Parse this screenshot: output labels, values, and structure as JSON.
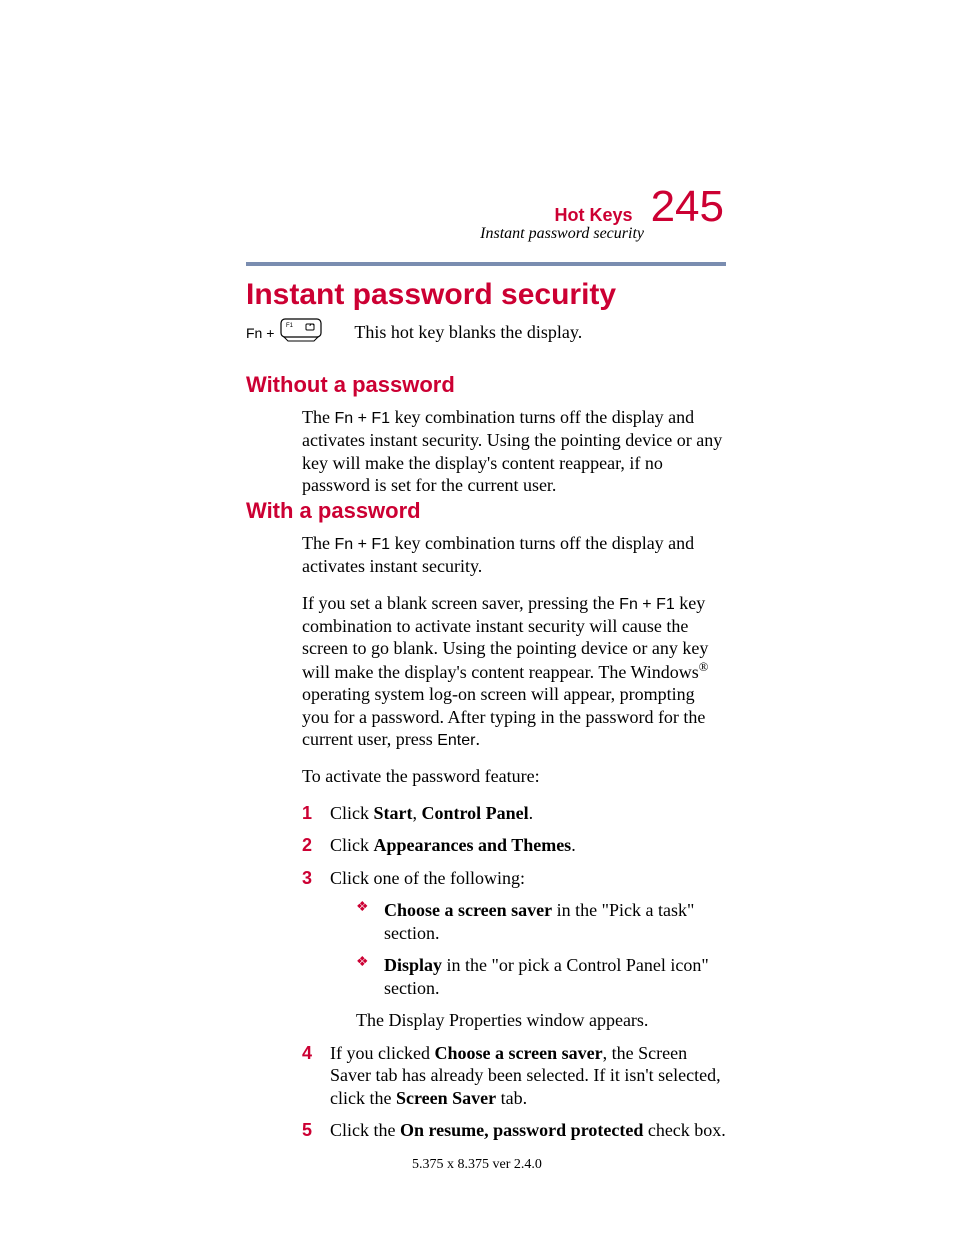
{
  "header": {
    "chapter": "Hot Keys",
    "pagenum": "245",
    "section": "Instant password security"
  },
  "title": "Instant password security",
  "hotkey": {
    "prefix": "Fn +",
    "keylabel": "F1",
    "desc": "This hot key blanks the display."
  },
  "without": {
    "title": "Without a password",
    "para_a": "The ",
    "para_key": "Fn + F1",
    "para_b": " key combination turns off the display and activates instant security. Using the pointing device or any key will make the display's content reappear, if no password is set for the current user."
  },
  "with": {
    "title": "With a password",
    "p1_a": "The ",
    "p1_key": "Fn + F1",
    "p1_b": " key combination turns off the display and activates instant security.",
    "p2_a": "If you set a blank screen saver, pressing the ",
    "p2_key": "Fn + F1",
    "p2_b": " key combination to activate instant security will cause the screen to go blank. Using the pointing device or any key will make the display's content reappear. The Windows",
    "p2_reg": "®",
    "p2_c": " operating system log-on screen will appear, prompting you for a password. After typing in the password for the current user, press ",
    "p2_enter": "Enter",
    "p2_d": ".",
    "intro": "To activate the password feature:",
    "s1_a": "Click ",
    "s1_b": "Start",
    "s1_c": ", ",
    "s1_d": "Control Panel",
    "s1_e": ".",
    "s2_a": "Click ",
    "s2_b": "Appearances and Themes",
    "s2_c": ".",
    "s3": "Click one of the following:",
    "s3a_b": "Choose a screen saver",
    "s3a_t": " in the \"Pick a task\" section.",
    "s3b_b": "Display",
    "s3b_t": " in the \"or pick a Control Panel icon\" section.",
    "s3after": "The Display Properties window appears.",
    "s4_a": " If you clicked ",
    "s4_b": "Choose a screen saver",
    "s4_c": ", the Screen Saver tab has already been selected. If it isn't selected, click the ",
    "s4_d": "Screen Saver",
    "s4_e": " tab.",
    "s5_a": "Click the ",
    "s5_b": "On resume, password protected",
    "s5_c": " check box."
  },
  "footer": "5.375 x 8.375 ver 2.4.0"
}
